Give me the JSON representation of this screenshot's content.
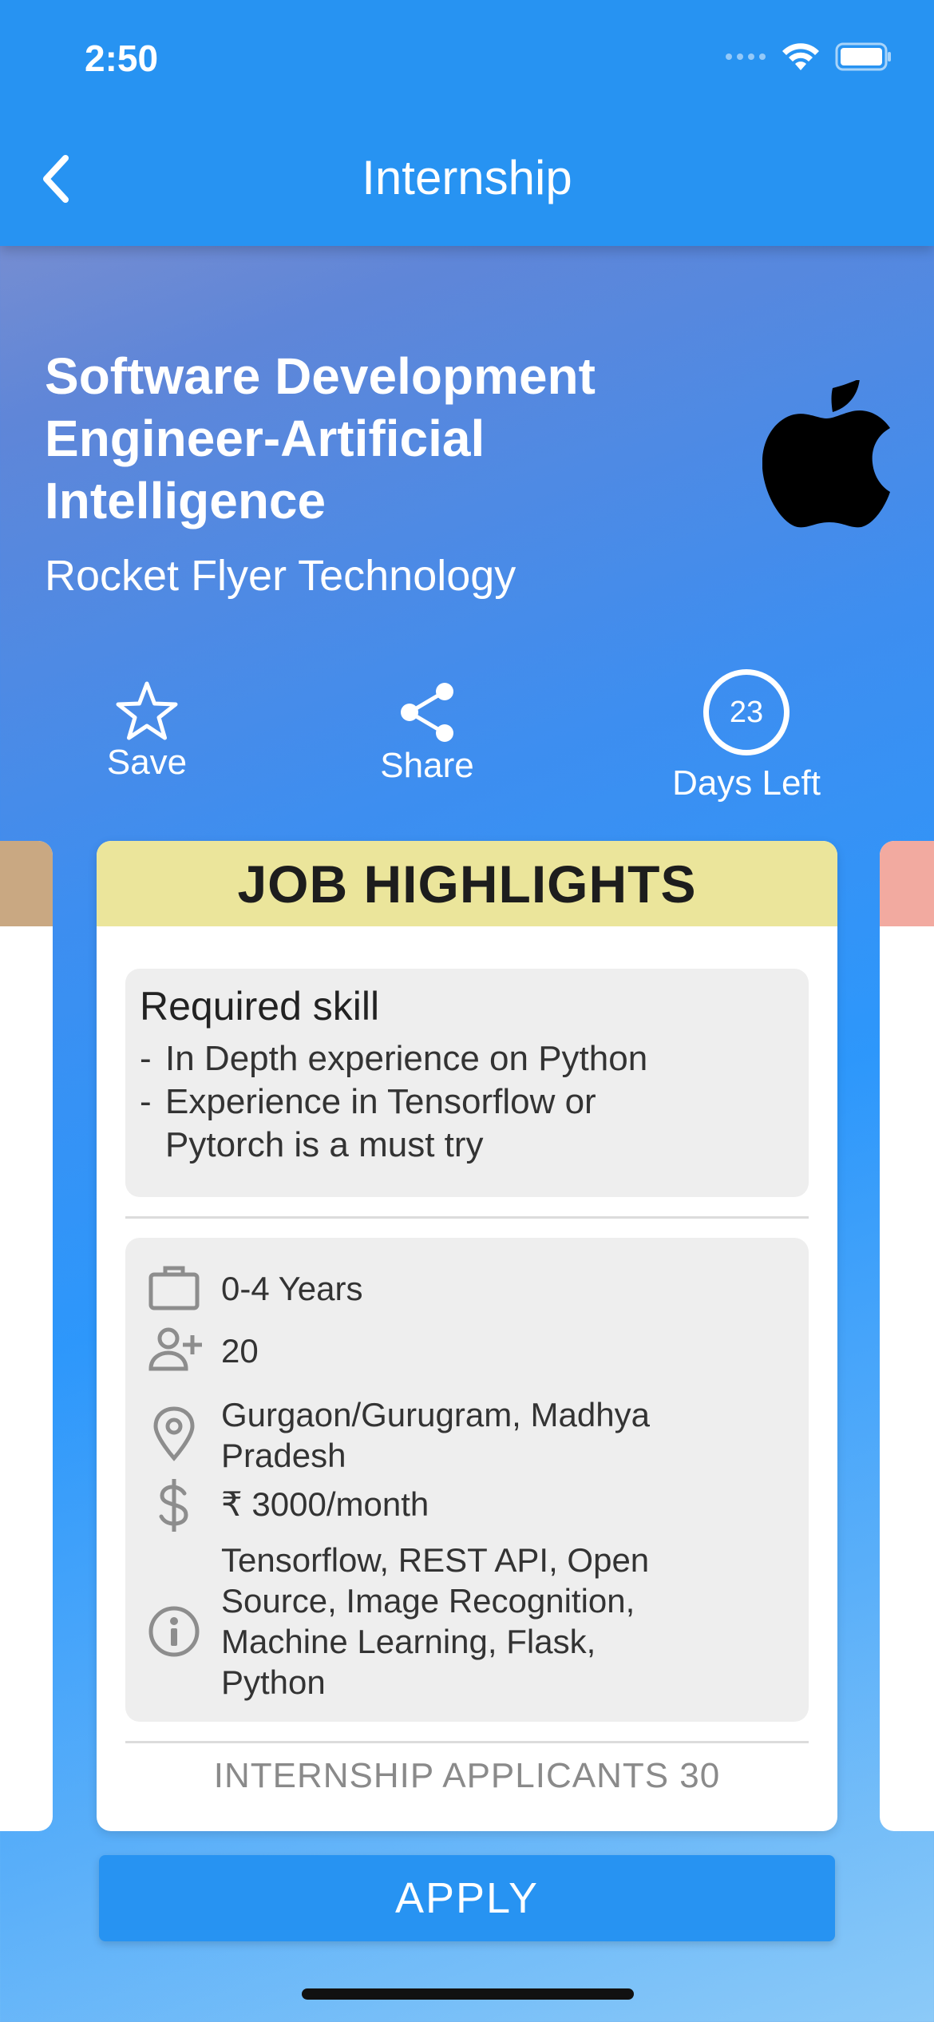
{
  "status_bar": {
    "time": "2:50"
  },
  "nav": {
    "title": "Internship"
  },
  "job": {
    "title": "Software Development Engineer-Artificial Intelligence",
    "company": "Rocket Flyer Technology"
  },
  "actions": {
    "save_label": "Save",
    "share_label": "Share",
    "days_left_value": "23",
    "days_left_label": "Days Left"
  },
  "highlights": {
    "header": "JOB HIGHLIGHTS",
    "skill_title": "Required skill",
    "skills": [
      "In Depth experience on Python",
      "Experience in Tensorflow or Pytorch is a must try"
    ],
    "experience": "0-4 Years",
    "openings": "20",
    "location": "Gurgaon/Gurugram, Madhya Pradesh",
    "stipend": "₹ 3000/month",
    "tags": "Tensorflow, REST API, Open Source, Image Recognition, Machine Learning, Flask, Python",
    "applicants": "INTERNSHIP APPLICANTS 30"
  },
  "apply": {
    "label": "APPLY"
  },
  "colors": {
    "primary": "#2793f2",
    "highlight_header": "#ebe59b",
    "left_card_band": "#c9a882",
    "right_card_band": "#f2aaa0"
  },
  "icons": [
    "chevron-left-icon",
    "star-icon",
    "share-icon",
    "briefcase-icon",
    "person-add-icon",
    "location-pin-icon",
    "dollar-icon",
    "info-icon",
    "apple-logo"
  ]
}
